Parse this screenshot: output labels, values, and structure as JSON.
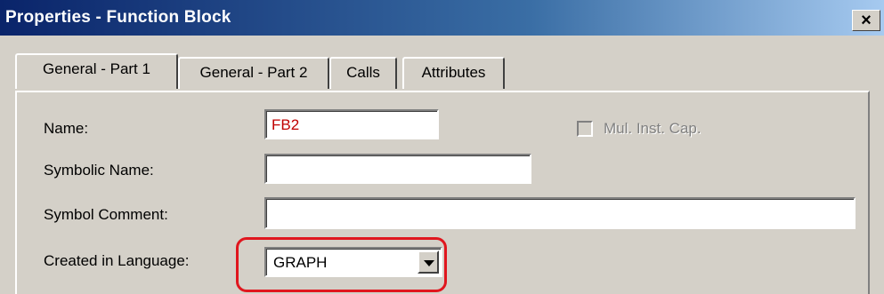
{
  "window": {
    "title": "Properties - Function Block",
    "close_symbol": "×"
  },
  "tabs": [
    {
      "label": "General - Part 1",
      "active": true
    },
    {
      "label": "General - Part 2",
      "active": false
    },
    {
      "label": "Calls",
      "active": false
    },
    {
      "label": "Attributes",
      "active": false
    }
  ],
  "form": {
    "name_label": "Name:",
    "name_value": "FB2",
    "name_value_color": "#c00000",
    "mul_inst_label": "Mul. Inst. Cap.",
    "symbolic_name_label": "Symbolic Name:",
    "symbolic_name_value": "",
    "symbol_comment_label": "Symbol Comment:",
    "symbol_comment_value": "",
    "language_label": "Created in Language:",
    "language_value": "GRAPH"
  },
  "colors": {
    "highlight": "#e0161e",
    "dialog_bg": "#d4d0c8",
    "title_start": "#0a246a",
    "title_end": "#a6caf0"
  }
}
